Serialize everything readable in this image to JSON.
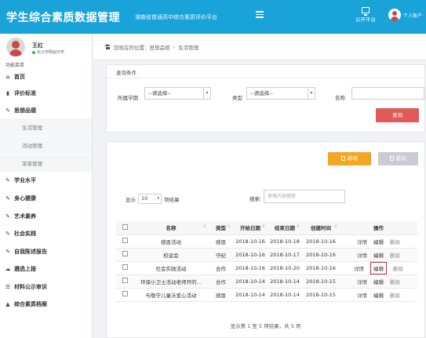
{
  "header": {
    "app_title": "学生综合素质数据管理",
    "subtitle": "湖南省普通高中综合素质评价平台",
    "public_platform": "公开平台",
    "account": "个人账户"
  },
  "sidebar": {
    "user_name": "王红",
    "school": "长沙市明远中学",
    "menu_heading": "功能菜单",
    "items": [
      {
        "label": "首页",
        "icon": "home-icon"
      },
      {
        "label": "评价标准",
        "icon": "book-icon"
      },
      {
        "label": "思想品德",
        "icon": "edit-icon"
      },
      {
        "label": "生活管理"
      },
      {
        "label": "活动管理"
      },
      {
        "label": "荣誉管理"
      },
      {
        "label": "学业水平",
        "icon": "edit-icon"
      },
      {
        "label": "身心健康",
        "icon": "edit-icon"
      },
      {
        "label": "艺术素养",
        "icon": "edit-icon"
      },
      {
        "label": "社会实践",
        "icon": "edit-icon"
      },
      {
        "label": "自我陈述报告",
        "icon": "edit-icon"
      },
      {
        "label": "遴选上报",
        "icon": "upload-icon"
      },
      {
        "label": "材料公示审诉",
        "icon": "list-icon"
      },
      {
        "label": "综合素质档案",
        "icon": "graduation-cap-icon"
      }
    ]
  },
  "breadcrumb": {
    "prefix": "您现在的位置：思想品德",
    "current": "生活管理"
  },
  "query": {
    "title": "查询条件",
    "term_label": "所属学期",
    "term_value": "--请选择--",
    "type_label": "类型",
    "type_value": "--请选择--",
    "name_label": "名称",
    "name_value": "",
    "query_button": "查询"
  },
  "toolbar": {
    "add_label": "新增",
    "delete_label": "删除"
  },
  "list": {
    "show_prefix": "显示",
    "page_size": "10",
    "show_suffix": "项结果",
    "search_label": "搜索:",
    "search_placeholder": "表格内容搜索",
    "columns": [
      "名称",
      "类型",
      "开始日期",
      "结束日期",
      "创建时间",
      "操作"
    ],
    "rows": [
      {
        "name": "感恩活动",
        "type": "感恩",
        "start": "2018-10-16",
        "end": "2018-10-18",
        "created": "2018-10-16"
      },
      {
        "name": "校运会",
        "type": "守纪",
        "start": "2018-10-16",
        "end": "2018-10-17",
        "created": "2018-10-16"
      },
      {
        "name": "社会实践活动",
        "type": "合作",
        "start": "2018-10-16",
        "end": "2018-10-20",
        "created": "2018-10-16"
      },
      {
        "name": "环保小卫士活动老师开的...",
        "type": "合作",
        "start": "2018-10-14",
        "end": "2018-10-14",
        "created": "2018-10-15"
      },
      {
        "name": "与敬守儿童沃爱心活动",
        "type": "感恩",
        "start": "2018-10-14",
        "end": "2018-10-14",
        "created": "2018-10-15"
      }
    ],
    "action_details": "详情",
    "action_edit": "编辑",
    "action_delete": "删除",
    "highlighted_row": 2,
    "footer": "显示第 1 至 5 项结果，共 5 项"
  }
}
